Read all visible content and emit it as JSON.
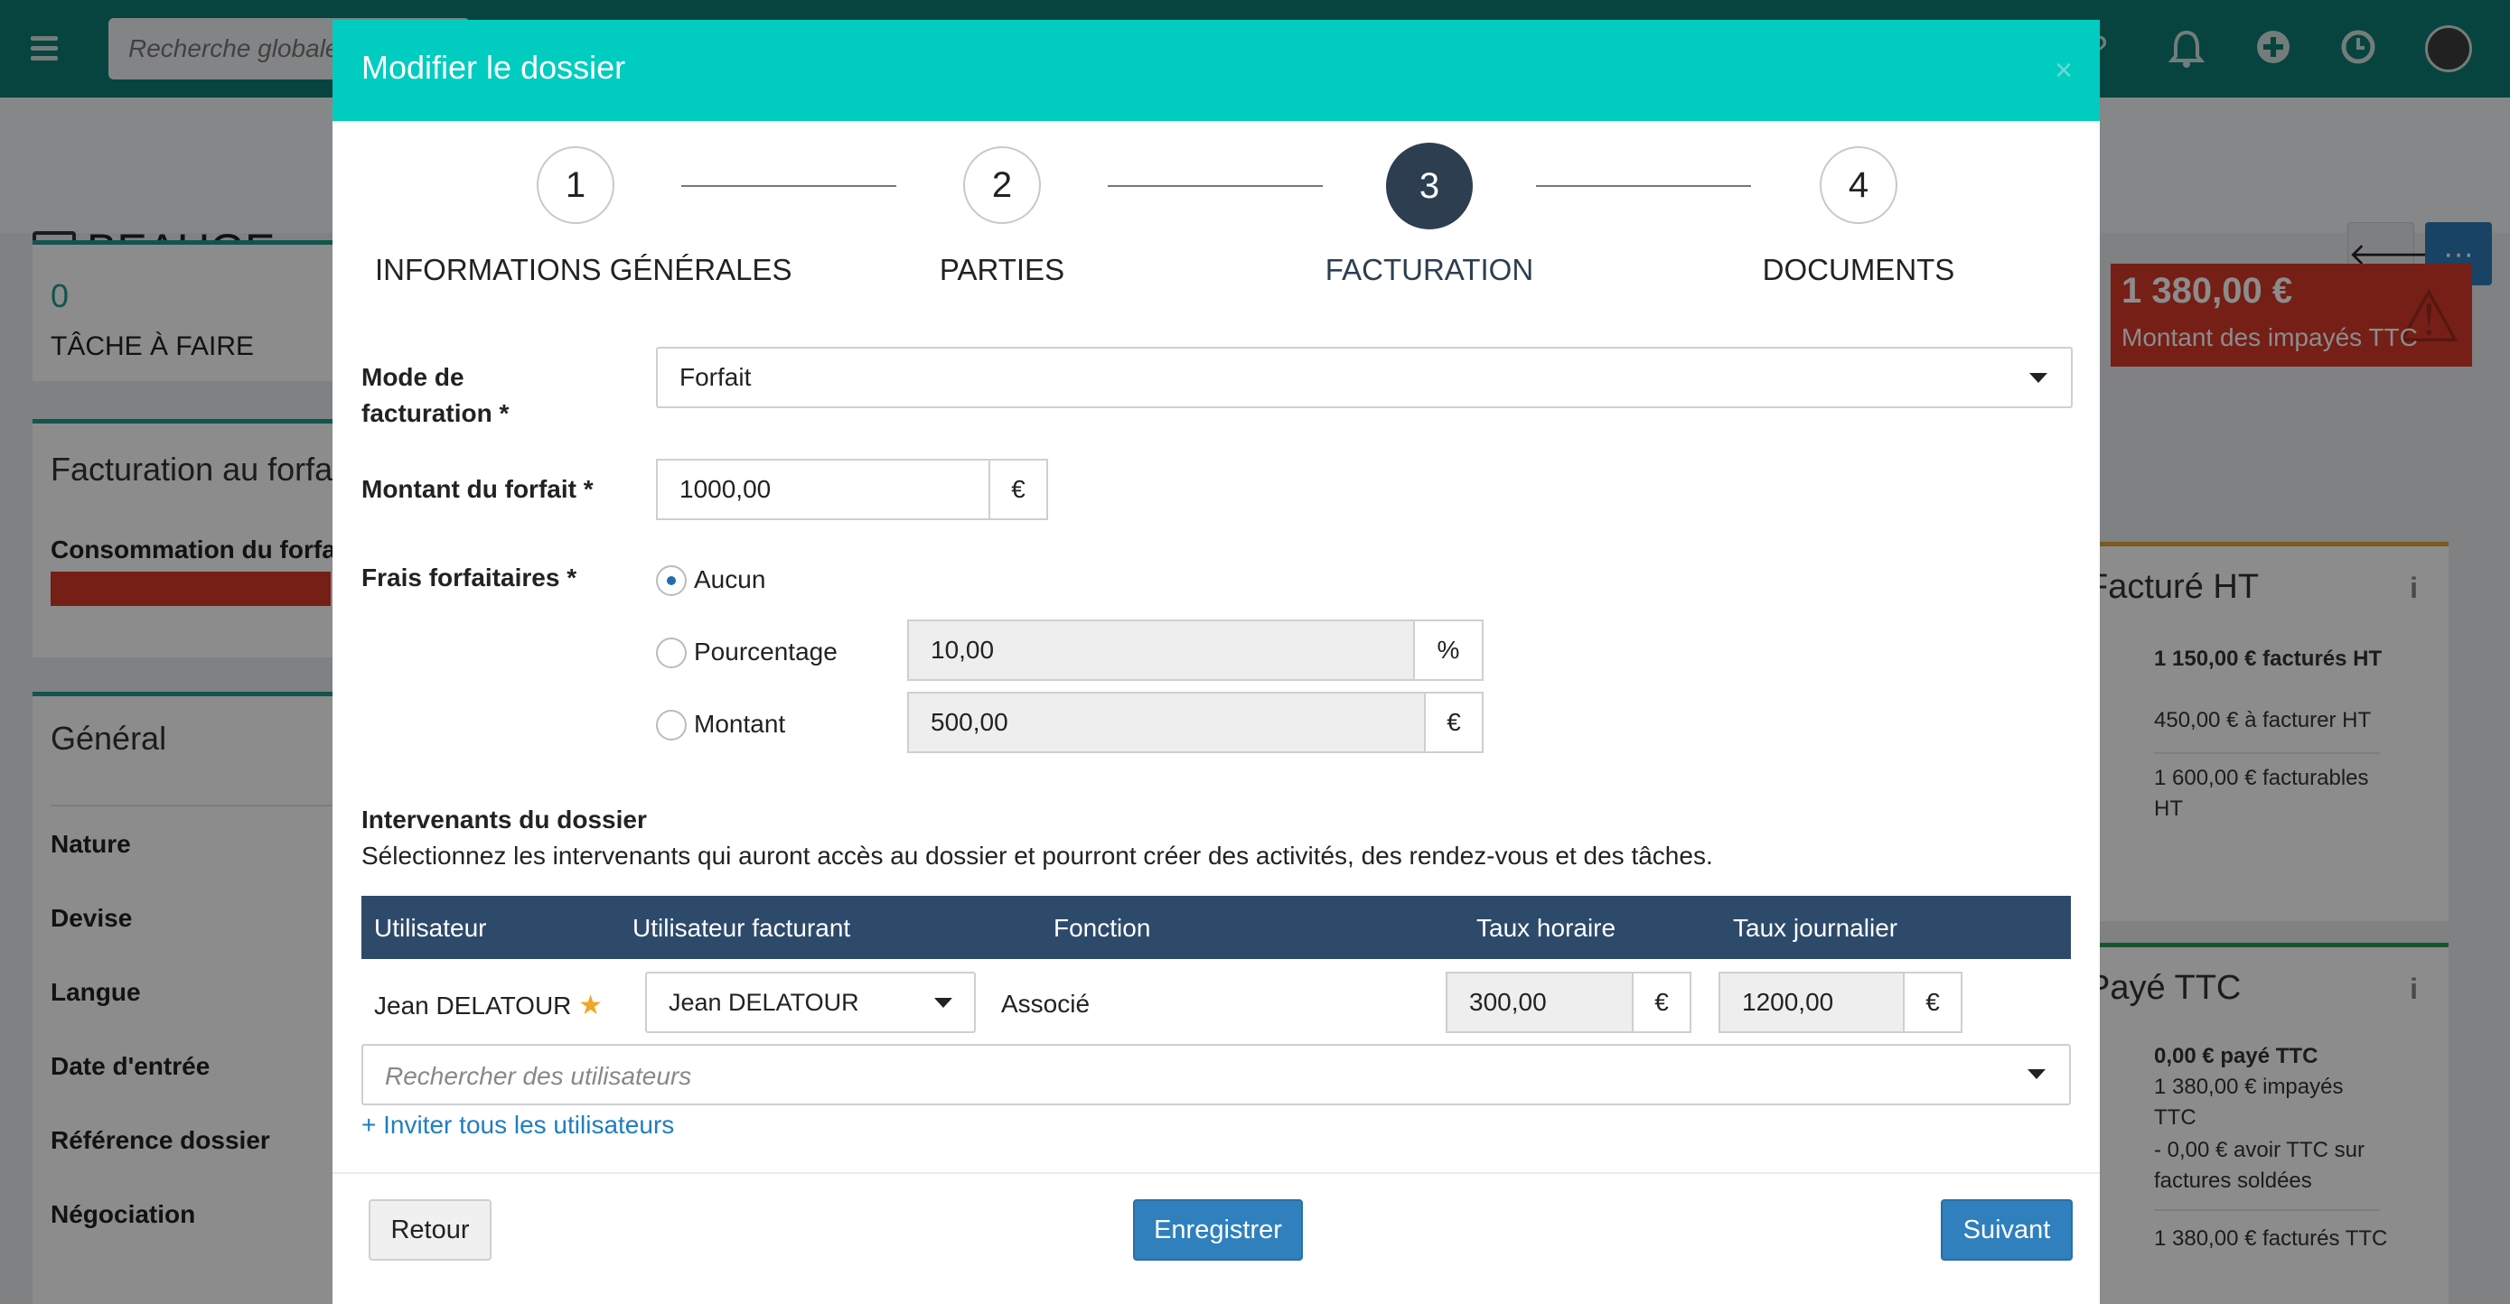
{
  "app": {
    "search_placeholder": "Recherche globale",
    "page_title": "BEAUGE - a",
    "tasks_count": "0",
    "tasks_label": "TÂCHE À FAIRE",
    "billing_card_title": "Facturation au forfa",
    "billing_consumption_label": "Consommation du forfa",
    "general_title": "Général",
    "general_rows": [
      "Nature",
      "Devise",
      "Langue",
      "Date d'entrée",
      "Référence dossier",
      "Négociation"
    ],
    "unpaid_amount": "1 380,00 €",
    "unpaid_label": "Montant des impayés TTC",
    "ht_card": {
      "title": "Facturé HT",
      "lines": [
        "1 150,00 € facturés HT",
        "450,00 € à facturer HT",
        "1 600,00 € facturables HT"
      ]
    },
    "ttc_card": {
      "title": "Payé TTC",
      "lines": [
        "0,00 € payé TTC",
        "1 380,00 € impayés TTC",
        "- 0,00 € avoir TTC sur factures soldées",
        "1 380,00 € facturés TTC"
      ]
    }
  },
  "modal": {
    "title": "Modifier le dossier",
    "close": "×",
    "steps": [
      {
        "number": "1",
        "label": "INFORMATIONS GÉNÉRALES"
      },
      {
        "number": "2",
        "label": "PARTIES"
      },
      {
        "number": "3",
        "label": "FACTURATION"
      },
      {
        "number": "4",
        "label": "DOCUMENTS"
      }
    ],
    "active_step": 3,
    "billing_mode": {
      "label_line1": "Mode de",
      "label_line2": "facturation *",
      "value": "Forfait"
    },
    "flat_amount": {
      "label": "Montant du forfait *",
      "value": "1000,00",
      "unit": "€"
    },
    "flat_fees": {
      "label": "Frais forfaitaires *",
      "options": [
        {
          "label": "Aucun",
          "checked": true
        },
        {
          "label": "Pourcentage",
          "checked": false,
          "value": "10,00",
          "unit": "%"
        },
        {
          "label": "Montant",
          "checked": false,
          "value": "500,00",
          "unit": "€"
        }
      ]
    },
    "stakeholders": {
      "title": "Intervenants du dossier",
      "description": "Sélectionnez les intervenants qui auront accès au dossier et pourront créer des activités, des rendez-vous et des tâches.",
      "columns": [
        "Utilisateur",
        "Utilisateur facturant",
        "Fonction",
        "Taux horaire",
        "Taux journalier"
      ],
      "rows": [
        {
          "user": "Jean DELATOUR",
          "billing_user": "Jean DELATOUR",
          "function": "Associé",
          "hourly_rate": "300,00",
          "daily_rate": "1200,00",
          "currency": "€"
        }
      ],
      "search_placeholder": "Rechercher des utilisateurs",
      "invite_link": "+ Inviter tous les utilisateurs"
    },
    "buttons": {
      "back": "Retour",
      "save": "Enregistrer",
      "next": "Suivant"
    }
  },
  "colors": {
    "modal_header": "#00ccc0",
    "active_step": "#2d3e50",
    "table_header": "#2d4a6b",
    "primary_button": "#2f80bd",
    "unpaid_card": "#d63a2a",
    "topbar": "#0f7d74"
  },
  "icons": [
    "menu-icon",
    "bell-icon",
    "plus-circle-icon",
    "clock-icon",
    "briefcase-icon",
    "arrow-left-icon",
    "more-icon",
    "warning-icon",
    "info-icon",
    "star-icon",
    "chevron-down-icon",
    "close-icon"
  ]
}
